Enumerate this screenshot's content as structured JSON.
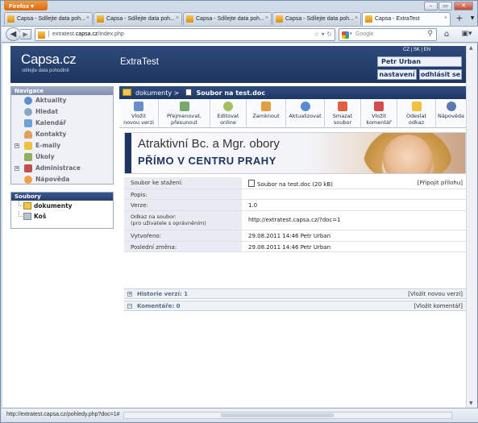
{
  "browser": {
    "app_button": "Firefox",
    "tabs": [
      {
        "label": "Capsa - Sdílejte data poh..."
      },
      {
        "label": "Capsa - Sdílejte data poh..."
      },
      {
        "label": "Capsa - Sdílejte data poh..."
      },
      {
        "label": "Capsa - Sdílejte data poh..."
      },
      {
        "label": "Capsa - ExtraTest",
        "active": true
      }
    ],
    "url_prefix": "extratest.",
    "url_domain": "capsa.cz",
    "url_path": "/index.php",
    "search_placeholder": "Google",
    "status_text": "http://extratest.capsa.cz/pohledy.php?doc=1#"
  },
  "site": {
    "logo": "Capsa.cz",
    "tagline": "sdílejte data pohodlně",
    "name": "ExtraTest",
    "langs": "CZ  | SK  | EN ",
    "user": "Petr Urban",
    "settings_button": "nastavení",
    "logout_button": "odhlásit se"
  },
  "sidebar": {
    "nav_title": "Navigace",
    "items": [
      {
        "label": "Aktuality",
        "icon": "info-icon",
        "color": "#5b8fd0"
      },
      {
        "label": "Hledat",
        "icon": "search-icon",
        "color": "#8ca4c4"
      },
      {
        "label": "Kalendář",
        "icon": "calendar-icon",
        "color": "#6ea0d6"
      },
      {
        "label": "Kontakty",
        "icon": "contacts-icon",
        "color": "#e0a060"
      },
      {
        "label": "E-maily",
        "icon": "email-icon",
        "color": "#f0c040",
        "expandable": true
      },
      {
        "label": "Úkoly",
        "icon": "tasks-icon",
        "color": "#90b060"
      },
      {
        "label": "Administrace",
        "icon": "admin-icon",
        "color": "#c05050",
        "expandable": true
      },
      {
        "label": "Nápověda",
        "icon": "help-icon",
        "color": "#f0a040"
      }
    ],
    "files_title": "Soubory",
    "files": [
      {
        "label": "dokumenty",
        "icon": "folder-icon"
      },
      {
        "label": "Koš",
        "icon": "trash-icon"
      }
    ]
  },
  "main": {
    "breadcrumb_folder": "dokumenty >",
    "breadcrumb_file": "Soubor na test.doc",
    "toolbar": [
      {
        "label": "Vložit\nnovou verzi",
        "icon": "upload-version-icon",
        "color": "#6a8fc8"
      },
      {
        "label": "Přejmenovat,\npřesunout",
        "icon": "rename-icon",
        "color": "#7aa86a"
      },
      {
        "label": "Editovat\nonline",
        "icon": "edit-online-icon",
        "color": "#a0c060"
      },
      {
        "label": "Zamknout",
        "icon": "lock-icon",
        "color": "#e0a040"
      },
      {
        "label": "Aktualizovat",
        "icon": "refresh-icon",
        "color": "#5a8ad0"
      },
      {
        "label": "Smazat\nsoubor",
        "icon": "delete-icon",
        "color": "#e06040"
      },
      {
        "label": "Vložit\nkomentář",
        "icon": "comment-icon",
        "color": "#d05050"
      },
      {
        "label": "Odeslat\nodkaz",
        "icon": "send-link-icon",
        "color": "#f0c040"
      },
      {
        "label": "Nápověda",
        "icon": "help-icon",
        "color": "#5a7ab0"
      }
    ],
    "banner_line1": "Atraktivní Bc. a Mgr. obory",
    "banner_line2": "PŘÍMO V CENTRU PRAHY",
    "info": [
      {
        "label": "Soubor ke stažení:",
        "value": "Soubor na test.doc (20 kB)",
        "action": "[Připojit přílohu]"
      },
      {
        "label": "Popis:",
        "value": ""
      },
      {
        "label": "Verze:",
        "value": "1.0"
      },
      {
        "label": "Odkaz na soubor:\n(pro uživatele s oprávněním)",
        "value": "http://extratest.capsa.cz/?doc=1"
      },
      {
        "label": "Vytvořeno:",
        "value": "29.08.2011 14:46 Petr Urban"
      },
      {
        "label": "Poslední změna:",
        "value": "29.08.2011 14:46 Petr Urban"
      }
    ],
    "history_label": "Historie verzí: 1",
    "history_action": "[Vložit novou verzi]",
    "comments_label": "Komentáře: 0",
    "comments_action": "[Vložit komentář]"
  }
}
